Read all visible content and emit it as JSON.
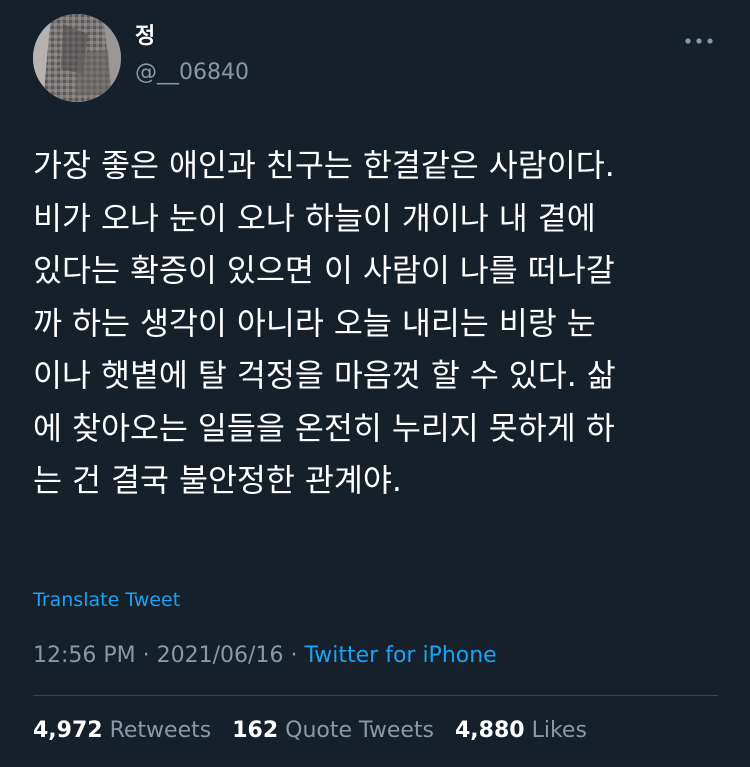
{
  "user": {
    "display_name": "정",
    "handle": "@__06840",
    "avatar_icon": "profile-photo"
  },
  "tweet": {
    "text": "가장 좋은 애인과 친구는 한결같은 사람이다.\n비가 오나 눈이 오나 하늘이 개이나 내 곁에\n있다는 확증이 있으면 이 사람이 나를 떠나갈\n까 하는 생각이 아니라 오늘 내리는 비랑 눈\n이나 햇볕에 탈 걱정을 마음껏 할 수 있다. 삶\n에 찾아오는 일들을 온전히 누리지 못하게 하\n는 건 결국 불안정한 관계야.",
    "translate_label": "Translate Tweet",
    "time": "12:56 PM",
    "separator": "·",
    "date": "2021/06/16",
    "source": "Twitter for iPhone"
  },
  "stats": {
    "retweets_count": "4,972",
    "retweets_label": "Retweets",
    "quotes_count": "162",
    "quotes_label": "Quote Tweets",
    "likes_count": "4,880",
    "likes_label": "Likes"
  },
  "icons": {
    "more": "more-horizontal-icon"
  },
  "colors": {
    "background": "#15202b",
    "accent": "#1da1f2",
    "secondary_text": "#8899a6",
    "divider": "#38444d"
  }
}
